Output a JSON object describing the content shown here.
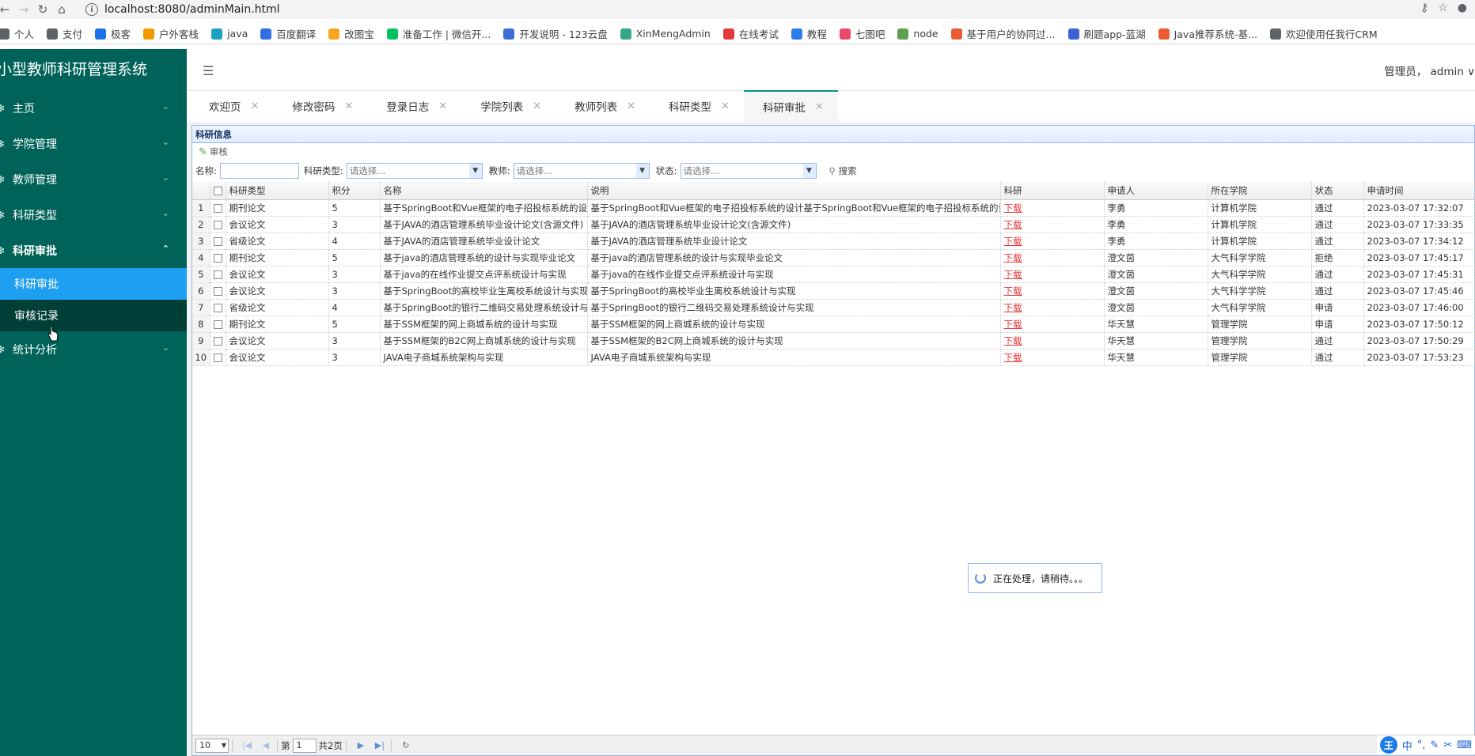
{
  "browser": {
    "url": "localhost:8080/adminMain.html",
    "bookmarks": [
      {
        "label": "个人",
        "color": "#5f6368"
      },
      {
        "label": "支付",
        "color": "#5f6368"
      },
      {
        "label": "极客",
        "color": "#1a73e8"
      },
      {
        "label": "户外客栈",
        "color": "#f29900"
      },
      {
        "label": "java",
        "color": "#1ea0c3"
      },
      {
        "label": "百度翻译",
        "color": "#2f6ee3"
      },
      {
        "label": "改图宝",
        "color": "#f5a623"
      },
      {
        "label": "准备工作 | 微信开...",
        "color": "#07c160"
      },
      {
        "label": "开发说明 - 123云盘",
        "color": "#3b6fd6"
      },
      {
        "label": "XinMengAdmin",
        "color": "#36a58a"
      },
      {
        "label": "在线考试",
        "color": "#e4393c"
      },
      {
        "label": "教程",
        "color": "#2b7de9"
      },
      {
        "label": "七图吧",
        "color": "#e94a67"
      },
      {
        "label": "node",
        "color": "#5fa04e"
      },
      {
        "label": "基于用户的协同过...",
        "color": "#ea5b33"
      },
      {
        "label": "刷题app-蓝湖",
        "color": "#3b62d6"
      },
      {
        "label": "Java推荐系统-基...",
        "color": "#ea5b33"
      },
      {
        "label": "欢迎使用任我行CRM",
        "color": "#5f6368"
      }
    ]
  },
  "sidebar": {
    "title": "小型教师科研管理系统",
    "menu": [
      {
        "label": "主页"
      },
      {
        "label": "学院管理"
      },
      {
        "label": "教师管理"
      },
      {
        "label": "科研类型"
      },
      {
        "label": "科研审批"
      },
      {
        "label": "统计分析"
      }
    ],
    "submenu": [
      {
        "label": "科研审批"
      },
      {
        "label": "审核记录"
      }
    ]
  },
  "topbar": {
    "user": "管理员， admin ∨"
  },
  "tabs": [
    {
      "label": "欢迎页"
    },
    {
      "label": "修改密码"
    },
    {
      "label": "登录日志"
    },
    {
      "label": "学院列表"
    },
    {
      "label": "教师列表"
    },
    {
      "label": "科研类型"
    },
    {
      "label": "科研审批"
    }
  ],
  "panel": {
    "title": "科研信息",
    "audit_label": "审核",
    "search": {
      "name_label": "名称:",
      "type_label": "科研类型:",
      "teacher_label": "教师:",
      "status_label": "状态:",
      "placeholder": "请选择...",
      "search_label": "搜索"
    },
    "columns": [
      "科研类型",
      "积分",
      "名称",
      "说明",
      "科研",
      "申请人",
      "所在学院",
      "状态",
      "申请时间"
    ],
    "rows": [
      {
        "n": "1",
        "type": "期刊论文",
        "score": "5",
        "name": "基于SpringBoot和Vue框架的电子招投标系统的设计基于SpringBoot和Vue框架的电子招投标系统的设计",
        "desc": "基于SpringBoot和Vue框架的电子招投标系统的设计基于SpringBoot和Vue框架的电子招投标系统的设计",
        "file": "下载",
        "applicant": "李勇",
        "college": "计算机学院",
        "status": "通过",
        "time": "2023-03-07 17:32:07"
      },
      {
        "n": "2",
        "type": "会议论文",
        "score": "3",
        "name": "基于JAVA的酒店管理系统毕业设计论文(含源文件)",
        "desc": "基于JAVA的酒店管理系统毕业设计论文(含源文件)",
        "file": "下载",
        "applicant": "李勇",
        "college": "计算机学院",
        "status": "通过",
        "time": "2023-03-07 17:33:35"
      },
      {
        "n": "3",
        "type": "省级论文",
        "score": "4",
        "name": "基于JAVA的酒店管理系统毕业设计论文",
        "desc": "基于JAVA的酒店管理系统毕业设计论文",
        "file": "下载",
        "applicant": "李勇",
        "college": "计算机学院",
        "status": "通过",
        "time": "2023-03-07 17:34:12"
      },
      {
        "n": "4",
        "type": "期刊论文",
        "score": "5",
        "name": "基于java的酒店管理系统的设计与实现毕业论文",
        "desc": "基于java的酒店管理系统的设计与实现毕业论文",
        "file": "下载",
        "applicant": "澄文茵",
        "college": "大气科学学院",
        "status": "拒绝",
        "time": "2023-03-07 17:45:17"
      },
      {
        "n": "5",
        "type": "会议论文",
        "score": "3",
        "name": "基于java的在线作业提交点评系统设计与实现",
        "desc": "基于java的在线作业提交点评系统设计与实现",
        "file": "下载",
        "applicant": "澄文茵",
        "college": "大气科学学院",
        "status": "通过",
        "time": "2023-03-07 17:45:31"
      },
      {
        "n": "6",
        "type": "会议论文",
        "score": "3",
        "name": "基于SpringBoot的高校毕业生离校系统设计与实现",
        "desc": "基于SpringBoot的高校毕业生离校系统设计与实现",
        "file": "下载",
        "applicant": "澄文茵",
        "college": "大气科学学院",
        "status": "通过",
        "time": "2023-03-07 17:45:46"
      },
      {
        "n": "7",
        "type": "省级论文",
        "score": "4",
        "name": "基于SpringBoot的银行二维码交易处理系统设计与实现",
        "desc": "基于SpringBoot的银行二维码交易处理系统设计与实现",
        "file": "下载",
        "applicant": "澄文茵",
        "college": "大气科学学院",
        "status": "申请",
        "time": "2023-03-07 17:46:00"
      },
      {
        "n": "8",
        "type": "期刊论文",
        "score": "5",
        "name": "基于SSM框架的网上商城系统的设计与实现",
        "desc": "基于SSM框架的网上商城系统的设计与实现",
        "file": "下载",
        "applicant": "华天慧",
        "college": "管理学院",
        "status": "申请",
        "time": "2023-03-07 17:50:12"
      },
      {
        "n": "9",
        "type": "会议论文",
        "score": "3",
        "name": "基于SSM框架的B2C网上商城系统的设计与实现",
        "desc": "基于SSM框架的B2C网上商城系统的设计与实现",
        "file": "下载",
        "applicant": "华天慧",
        "college": "管理学院",
        "status": "通过",
        "time": "2023-03-07 17:50:29"
      },
      {
        "n": "10",
        "type": "会议论文",
        "score": "3",
        "name": "JAVA电子商城系统架构与实现",
        "desc": "JAVA电子商城系统架构与实现",
        "file": "下载",
        "applicant": "华天慧",
        "college": "管理学院",
        "status": "通过",
        "time": "2023-03-07 17:53:23"
      }
    ],
    "loading": "正在处理，请稍待。。。",
    "pager": {
      "page_size": "10",
      "page_label": "第",
      "page": "1",
      "total_label": "共2页"
    }
  },
  "ime": {
    "logo": "王",
    "lang": "中"
  }
}
